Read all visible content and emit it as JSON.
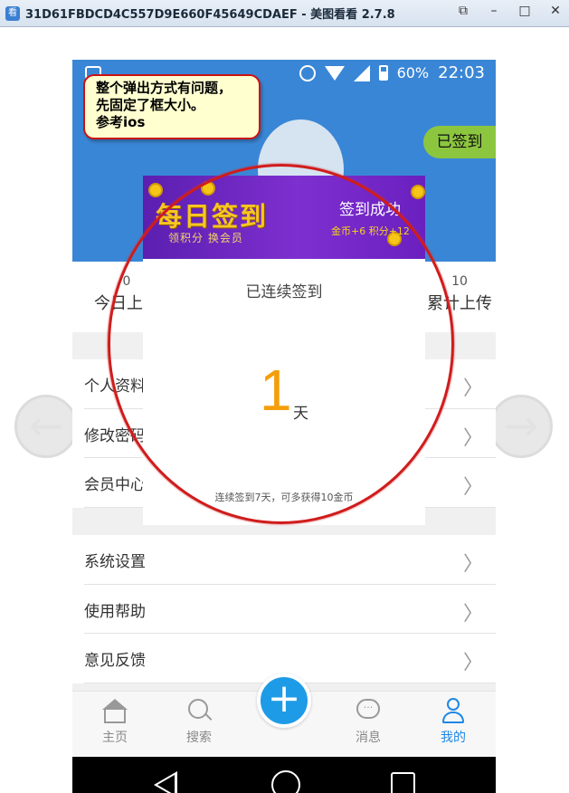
{
  "window": {
    "title": "31D61FBDCD4C557D9E660F45649CDAEF - 美图看看 2.7.8",
    "icon_text": "看"
  },
  "status_bar": {
    "battery": "60%",
    "time": "22:03"
  },
  "header": {
    "signed_button": "已签到"
  },
  "stats": {
    "left": {
      "number": "0",
      "label": "今日上传"
    },
    "right": {
      "number": "10",
      "label": "累计上传"
    }
  },
  "menu_group1": [
    {
      "label": "个人资料"
    },
    {
      "label": "修改密码"
    },
    {
      "label": "会员中心"
    }
  ],
  "menu_group2": [
    {
      "label": "系统设置"
    },
    {
      "label": "使用帮助"
    },
    {
      "label": "意见反馈"
    }
  ],
  "tabs": [
    {
      "label": "主页",
      "icon": "home-icon"
    },
    {
      "label": "搜索",
      "icon": "search-icon"
    },
    {
      "label": "消息",
      "icon": "message-icon"
    },
    {
      "label": "我的",
      "icon": "user-icon"
    }
  ],
  "dialog": {
    "banner_title": "每日签到",
    "banner_sub": "领积分 换会员",
    "success": "签到成功",
    "reward": "金币+6 积分+12",
    "heading": "已连续签到",
    "days": "1",
    "unit": "天",
    "footer": "连续签到7天，可多获得10金币"
  },
  "annotation": {
    "lines": [
      "整个弹出方式有问题，",
      "先固定了框大小。",
      "参考ios"
    ]
  },
  "colors": {
    "brand_blue": "#3a86d6",
    "signed_green": "#8cc63f",
    "day_orange": "#f59e0b",
    "banner_purple": "#6a20bf",
    "annotation_red": "#d01c1c"
  }
}
